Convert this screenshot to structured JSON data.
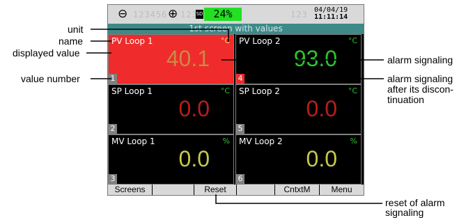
{
  "status_bar": {
    "left_icon": "arrow-circle-icon",
    "dim_digits_1": "123456",
    "mid_icon": "arrow-target-icon",
    "dim_digits_2": "123",
    "sd_label": "SD",
    "sd_percent": "24%",
    "dim_digits_3": "123",
    "date": "04/04/19",
    "time": "11:11:14"
  },
  "screen_title": "1st screen with values",
  "tiles": [
    {
      "name": "PV Loop 1",
      "unit": "°C",
      "value": "40.1",
      "number": "1",
      "state": "alarm",
      "value_color": "#c98a46",
      "unit_color": "#ffe070"
    },
    {
      "name": "PV Loop 2",
      "unit": "°C",
      "value": "93.0",
      "number": "4",
      "state": "alarm-after",
      "value_color": "#2fc22f",
      "unit_color": "#2fc22f"
    },
    {
      "name": "SP Loop 1",
      "unit": "°C",
      "value": "0.0",
      "number": "2",
      "state": "normal",
      "value_color": "#b81e1e",
      "unit_color": "#2fc22f"
    },
    {
      "name": "SP Loop 2",
      "unit": "°C",
      "value": "0.0",
      "number": "5",
      "state": "normal",
      "value_color": "#b81e1e",
      "unit_color": "#2fc22f"
    },
    {
      "name": "MV Loop 1",
      "unit": "%",
      "value": "0.0",
      "number": "3",
      "state": "normal",
      "value_color": "#c8c84a",
      "unit_color": "#2fc22f"
    },
    {
      "name": "MV Loop 2",
      "unit": "%",
      "value": "0.0",
      "number": "6",
      "state": "normal",
      "value_color": "#c8c84a",
      "unit_color": "#2fc22f"
    }
  ],
  "softkeys": [
    "Screens",
    "",
    "Reset",
    "",
    "CntxtM",
    "Menu"
  ],
  "annotations": {
    "unit": "unit",
    "name": "name",
    "displayed_value": "displayed value",
    "value_number": "value number",
    "alarm_signaling": "alarm signaling",
    "alarm_after_1": "alarm signaling",
    "alarm_after_2": "after its discon-",
    "alarm_after_3": "tinuation",
    "reset_1": "reset of alarm",
    "reset_2": "signaling"
  }
}
